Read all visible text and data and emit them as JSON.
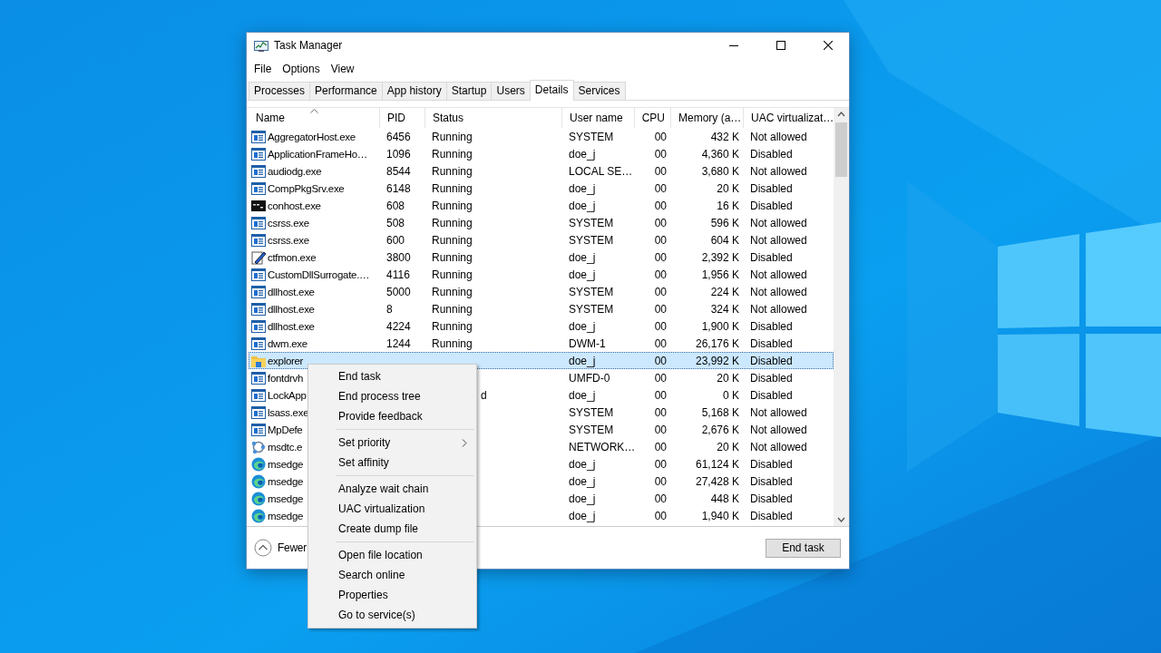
{
  "window": {
    "title": "Task Manager"
  },
  "menu_bar": [
    "File",
    "Options",
    "View"
  ],
  "tabs": [
    {
      "label": "Processes",
      "selected": false
    },
    {
      "label": "Performance",
      "selected": false
    },
    {
      "label": "App history",
      "selected": false
    },
    {
      "label": "Startup",
      "selected": false
    },
    {
      "label": "Users",
      "selected": false
    },
    {
      "label": "Details",
      "selected": true
    },
    {
      "label": "Services",
      "selected": false
    }
  ],
  "table": {
    "columns": [
      {
        "label": "Name",
        "sorted": true
      },
      {
        "label": "PID",
        "sorted": false
      },
      {
        "label": "Status",
        "sorted": false
      },
      {
        "label": "User name",
        "sorted": false
      },
      {
        "label": "CPU",
        "sorted": false
      },
      {
        "label": "Memory (a…",
        "sorted": false
      },
      {
        "label": "UAC virtualizat…",
        "sorted": false
      }
    ],
    "rows": [
      {
        "kind": "app",
        "name": "AggregatorHost.exe",
        "pid": "6456",
        "status": "Running",
        "user": "SYSTEM",
        "cpu": "00",
        "memory": "432 K",
        "uac": "Not allowed",
        "selected": false
      },
      {
        "kind": "app",
        "name": "ApplicationFrameHo…",
        "pid": "1096",
        "status": "Running",
        "user": "doe_j",
        "cpu": "00",
        "memory": "4,360 K",
        "uac": "Disabled",
        "selected": false
      },
      {
        "kind": "app",
        "name": "audiodg.exe",
        "pid": "8544",
        "status": "Running",
        "user": "LOCAL SE…",
        "cpu": "00",
        "memory": "3,680 K",
        "uac": "Not allowed",
        "selected": false
      },
      {
        "kind": "app",
        "name": "CompPkgSrv.exe",
        "pid": "6148",
        "status": "Running",
        "user": "doe_j",
        "cpu": "00",
        "memory": "20 K",
        "uac": "Disabled",
        "selected": false
      },
      {
        "kind": "console",
        "name": "conhost.exe",
        "pid": "608",
        "status": "Running",
        "user": "doe_j",
        "cpu": "00",
        "memory": "16 K",
        "uac": "Disabled",
        "selected": false
      },
      {
        "kind": "app",
        "name": "csrss.exe",
        "pid": "508",
        "status": "Running",
        "user": "SYSTEM",
        "cpu": "00",
        "memory": "596 K",
        "uac": "Not allowed",
        "selected": false
      },
      {
        "kind": "app",
        "name": "csrss.exe",
        "pid": "600",
        "status": "Running",
        "user": "SYSTEM",
        "cpu": "00",
        "memory": "604 K",
        "uac": "Not allowed",
        "selected": false
      },
      {
        "kind": "pen",
        "name": "ctfmon.exe",
        "pid": "3800",
        "status": "Running",
        "user": "doe_j",
        "cpu": "00",
        "memory": "2,392 K",
        "uac": "Disabled",
        "selected": false
      },
      {
        "kind": "app",
        "name": "CustomDllSurrogate.…",
        "pid": "4116",
        "status": "Running",
        "user": "doe_j",
        "cpu": "00",
        "memory": "1,956 K",
        "uac": "Not allowed",
        "selected": false
      },
      {
        "kind": "app",
        "name": "dllhost.exe",
        "pid": "5000",
        "status": "Running",
        "user": "SYSTEM",
        "cpu": "00",
        "memory": "224 K",
        "uac": "Not allowed",
        "selected": false
      },
      {
        "kind": "app",
        "name": "dllhost.exe",
        "pid": "8",
        "status": "Running",
        "user": "SYSTEM",
        "cpu": "00",
        "memory": "324 K",
        "uac": "Not allowed",
        "selected": false
      },
      {
        "kind": "app",
        "name": "dllhost.exe",
        "pid": "4224",
        "status": "Running",
        "user": "doe_j",
        "cpu": "00",
        "memory": "1,900 K",
        "uac": "Disabled",
        "selected": false
      },
      {
        "kind": "app",
        "name": "dwm.exe",
        "pid": "1244",
        "status": "Running",
        "user": "DWM-1",
        "cpu": "00",
        "memory": "26,176 K",
        "uac": "Disabled",
        "selected": false
      },
      {
        "kind": "folder",
        "name": "explorer",
        "user": "doe_j",
        "cpu": "00",
        "memory": "23,992 K",
        "uac": "Disabled",
        "selected": true
      },
      {
        "kind": "app",
        "name": "fontdrvh",
        "user": "UMFD-0",
        "cpu": "00",
        "memory": "20 K",
        "uac": "Disabled",
        "selected": false
      },
      {
        "kind": "app",
        "name": "LockApp",
        "status": "d",
        "user": "doe_j",
        "cpu": "00",
        "memory": "0 K",
        "uac": "Disabled",
        "selected": false
      },
      {
        "kind": "app",
        "name": "lsass.exe",
        "user": "SYSTEM",
        "cpu": "00",
        "memory": "5,168 K",
        "uac": "Not allowed",
        "selected": false
      },
      {
        "kind": "app",
        "name": "MpDefe",
        "user": "SYSTEM",
        "cpu": "00",
        "memory": "2,676 K",
        "uac": "Not allowed",
        "selected": false
      },
      {
        "kind": "network",
        "name": "msdtc.e",
        "user": "NETWORK…",
        "cpu": "00",
        "memory": "20 K",
        "uac": "Not allowed",
        "selected": false
      },
      {
        "kind": "browser",
        "name": "msedge",
        "user": "doe_j",
        "cpu": "00",
        "memory": "61,124 K",
        "uac": "Disabled",
        "selected": false
      },
      {
        "kind": "browser",
        "name": "msedge",
        "user": "doe_j",
        "cpu": "00",
        "memory": "27,428 K",
        "uac": "Disabled",
        "selected": false
      },
      {
        "kind": "browser",
        "name": "msedge",
        "user": "doe_j",
        "cpu": "00",
        "memory": "448 K",
        "uac": "Disabled",
        "selected": false
      },
      {
        "kind": "browser",
        "name": "msedge",
        "user": "doe_j",
        "cpu": "00",
        "memory": "1,940 K",
        "uac": "Disabled",
        "selected": false
      }
    ]
  },
  "footer": {
    "details_toggle": "Fewer",
    "end_task_button": "End task"
  },
  "context_menu": {
    "groups": [
      [
        {
          "label": "End task",
          "has_submenu": false
        },
        {
          "label": "End process tree",
          "has_submenu": false
        },
        {
          "label": "Provide feedback",
          "has_submenu": false
        }
      ],
      [
        {
          "label": "Set priority",
          "has_submenu": true
        },
        {
          "label": "Set affinity",
          "has_submenu": false
        }
      ],
      [
        {
          "label": "Analyze wait chain",
          "has_submenu": false
        },
        {
          "label": "UAC virtualization",
          "has_submenu": false
        },
        {
          "label": "Create dump file",
          "has_submenu": false
        }
      ],
      [
        {
          "label": "Open file location",
          "has_submenu": false
        },
        {
          "label": "Search online",
          "has_submenu": false
        },
        {
          "label": "Properties",
          "has_submenu": false
        },
        {
          "label": "Go to service(s)",
          "has_submenu": false
        }
      ]
    ]
  }
}
